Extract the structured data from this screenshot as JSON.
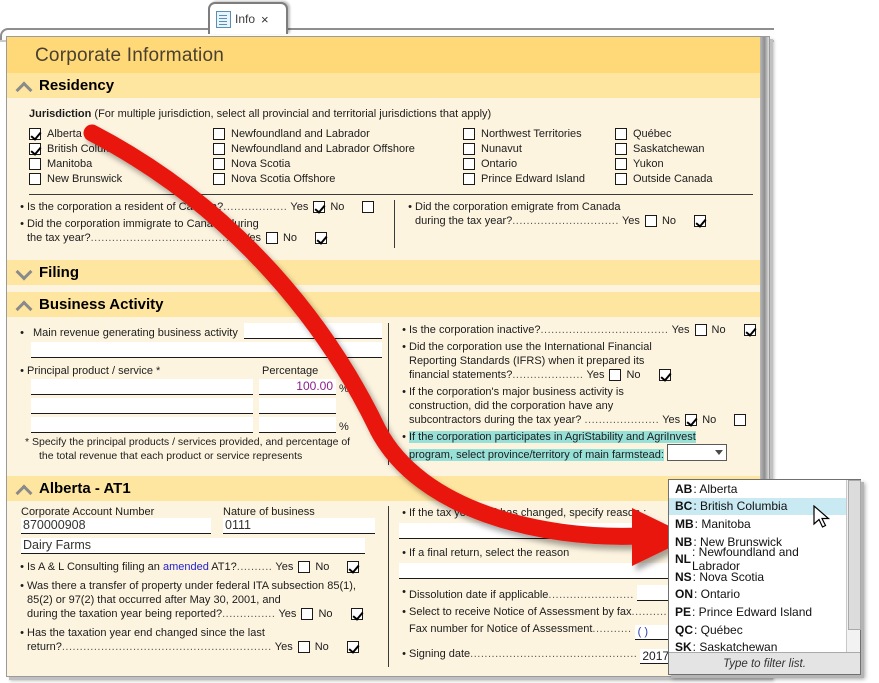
{
  "tab": {
    "label": "Info",
    "close": "×",
    "icon": "document-icon"
  },
  "page": {
    "title": "Corporate Information"
  },
  "residency": {
    "heading": "Residency",
    "jurisdiction_label": "Jurisdiction",
    "jurisdiction_hint": "(For multiple jurisdiction, select all provincial and territorial jurisdictions that apply)",
    "checkboxes": [
      {
        "label": "Alberta",
        "checked": true
      },
      {
        "label": "Newfoundland and Labrador",
        "checked": false
      },
      {
        "label": "Northwest Territories",
        "checked": false
      },
      {
        "label": "Québec",
        "checked": false
      },
      {
        "label": "British Columbia",
        "checked": true
      },
      {
        "label": "Newfoundland and Labrador Offshore",
        "checked": false
      },
      {
        "label": "Nunavut",
        "checked": false
      },
      {
        "label": "Saskatchewan",
        "checked": false
      },
      {
        "label": "Manitoba",
        "checked": false
      },
      {
        "label": "Nova Scotia",
        "checked": false
      },
      {
        "label": "Ontario",
        "checked": false
      },
      {
        "label": "Yukon",
        "checked": false
      },
      {
        "label": "New Brunswick",
        "checked": false
      },
      {
        "label": "Nova Scotia Offshore",
        "checked": false
      },
      {
        "label": "Prince Edward Island",
        "checked": false
      },
      {
        "label": "Outside Canada",
        "checked": false
      }
    ],
    "q1": {
      "text": "Is the corporation a resident of Canada?",
      "dots": "..................",
      "yes_label": "Yes",
      "no_label": "No",
      "yes": true,
      "no": false
    },
    "q2": {
      "text": "Did the corporation immigrate to Canada during",
      "text2": "the tax year?",
      "dots": "..........................................",
      "yes_label": "Yes",
      "no_label": "No",
      "yes": false,
      "no": true
    },
    "q3": {
      "text": "Did the corporation emigrate from Canada",
      "text2": "during the tax year?",
      "dots": "..............................",
      "yes_label": "Yes",
      "no_label": "No",
      "yes": false,
      "no": true
    }
  },
  "filing": {
    "heading": "Filing"
  },
  "business": {
    "heading": "Business Activity",
    "main_revenue_label": "Main revenue generating business activity",
    "main_revenue_value": "",
    "main_revenue_value2": "",
    "principal_label": "Principal product / service *",
    "percentage_label": "Percentage",
    "rows": [
      {
        "product": "",
        "pct": "100.00",
        "pct_sign": "%"
      },
      {
        "product": "",
        "pct": "",
        "pct_sign": ""
      },
      {
        "product": "",
        "pct": "",
        "pct_sign": "%"
      }
    ],
    "footnote1": "* Specify the principal products / services provided, and percentage of",
    "footnote2": "the total revenue that each product or service represents",
    "q1": {
      "text": "Is the corporation inactive?",
      "dots": "....................................",
      "yes_label": "Yes",
      "no_label": "No",
      "yes": false,
      "no": true
    },
    "q2": {
      "l1": "Did the corporation use the International Financial",
      "l2": "Reporting Standards (IFRS) when it prepared its",
      "l3": "financial statements?",
      "dots": "....................",
      "yes_label": "Yes",
      "no_label": "No",
      "yes": false,
      "no": true
    },
    "q3": {
      "l1": "If the corporation's major business activity is",
      "l2": "construction, did the corporation have any",
      "l3": "subcontractors during the tax year? ",
      "dots": ".....................",
      "yes_label": "Yes",
      "no_label": "No",
      "yes": true,
      "no": false
    },
    "q4": {
      "l1": "If the corporation participates in AgriStability and AgriInvest",
      "l2": "program, select province/territory of main farmstead:",
      "value": ""
    }
  },
  "at1": {
    "heading": "Alberta - AT1",
    "account_label": "Corporate Account Number",
    "account_value": "870000908",
    "nature_label": "Nature of business",
    "nature_value": "0111",
    "nature_desc": "Dairy Farms",
    "q1_pre": "Is A & L Consulting filing an ",
    "q1_link": "amended",
    "q1_post": " AT1?",
    "q1_dots": "..........",
    "q1_yes": false,
    "q1_no": true,
    "q2_l1": "Was there a transfer of property under federal ITA subsection 85(1),",
    "q2_l2": "85(2) or 97(2) that occurred after May 30, 2001, and",
    "q2_l3": "during the taxation year being reported?",
    "q2_dots": "...............",
    "q2_yes": false,
    "q2_no": true,
    "q3_l1": "Has the taxation year end changed since the last",
    "q3_l2": "return?",
    "q3_dots": "...........................................................",
    "q3_yes": false,
    "q3_no": true,
    "yes_label": "Yes",
    "no_label": "No",
    "r1": "If the tax year end has changed, specify reason :",
    "r1_value": "",
    "r2": "If a final return, select the reason",
    "r2_value": "",
    "r3": "Dissolution date if applicable",
    "r3_dots": "........................",
    "r3_value": "",
    "r4": "Select to receive Notice of Assessment by fax",
    "r4_dots": "..........",
    "r4_checked": false,
    "r5": "Fax number for Notice of Assessment",
    "r5_dots": "...........",
    "r5_value": "(        )",
    "r6": "Signing date",
    "r6_dots": "...............................................",
    "r6_value": "2017/04"
  },
  "dropdown": {
    "footer": "Type to filter list.",
    "selected_code": "BC",
    "items": [
      {
        "code": "AB",
        "name": "Alberta",
        "selected": false
      },
      {
        "code": "BC",
        "name": "British Columbia",
        "selected": true
      },
      {
        "code": "MB",
        "name": "Manitoba",
        "selected": false
      },
      {
        "code": "NB",
        "name": "New Brunswick",
        "selected": false
      },
      {
        "code": "NL",
        "name": "Newfoundland and Labrador",
        "selected": false
      },
      {
        "code": "NS",
        "name": "Nova Scotia",
        "selected": false
      },
      {
        "code": "ON",
        "name": "Ontario",
        "selected": false
      },
      {
        "code": "PE",
        "name": "Prince Edward Island",
        "selected": false
      },
      {
        "code": "QC",
        "name": "Québec",
        "selected": false
      },
      {
        "code": "SK",
        "name": "Saskatchewan",
        "selected": false
      }
    ]
  },
  "annotation": {
    "arrow_color": "#e8150f"
  },
  "colors": {
    "title_bar": "#ffd978",
    "section_bar": "#ffe6a0",
    "page_bg": "#fdf4e0",
    "highlight": "#97e0d8",
    "pct_text": "#8b1f8b",
    "link": "#2222cc",
    "dd_selected": "#c9eaf3"
  }
}
